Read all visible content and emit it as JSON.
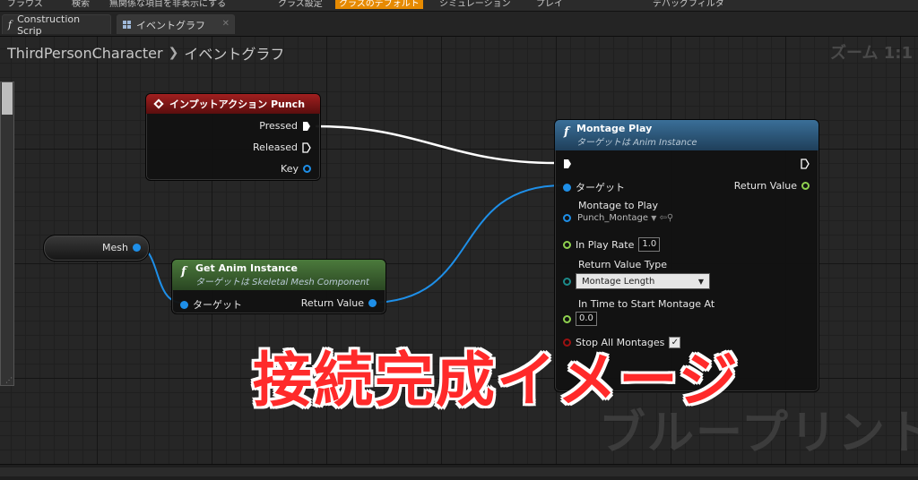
{
  "toolbar": {
    "items": [
      "ブラウズ",
      "検索",
      "無関係な項目を非表示にする",
      "クラス設定",
      "クラスのデフォルト",
      "シミュレーション",
      "プレイ",
      "デバッグフィルタ"
    ]
  },
  "tabs": [
    {
      "label": "Construction Scrip",
      "icon": "function-icon"
    },
    {
      "label": "イベントグラフ",
      "icon": "graph-icon"
    }
  ],
  "breadcrumb": {
    "root": "ThirdPersonCharacter",
    "current": "イベントグラフ"
  },
  "zoom_label": "ズーム 1:1",
  "watermark": "ブループリント",
  "overlay_text": "接続完成イメージ",
  "nodes": {
    "input_action": {
      "title": "インプットアクション Punch",
      "pins": {
        "pressed": "Pressed",
        "released": "Released",
        "key": "Key"
      }
    },
    "mesh_var": {
      "label": "Mesh"
    },
    "get_anim": {
      "title": "Get Anim Instance",
      "subtitle": "ターゲットは Skeletal Mesh Component",
      "pins": {
        "target": "ターゲット",
        "return": "Return Value"
      }
    },
    "montage_play": {
      "title": "Montage Play",
      "subtitle": "ターゲットは Anim Instance",
      "pins": {
        "target": "ターゲット",
        "return": "Return Value",
        "montage_to_play": "Montage to Play",
        "montage_value": "Punch_Montage",
        "in_play_rate": "In Play Rate",
        "in_play_rate_value": "1.0",
        "return_value_type": "Return Value Type",
        "return_value_type_selected": "Montage Length",
        "in_time": "In Time to Start Montage At",
        "in_time_value": "0.0",
        "stop_all": "Stop All Montages",
        "stop_all_checked": true
      }
    }
  },
  "colors": {
    "accent_orange": "#e68a00",
    "event_header": "#a11f1f",
    "pure_header": "#4b7a3c",
    "func_header": "#3a6f98",
    "object_pin": "#1e8fe8",
    "float_pin": "#8fd14f",
    "overlay_text": "#ff2a2a"
  }
}
